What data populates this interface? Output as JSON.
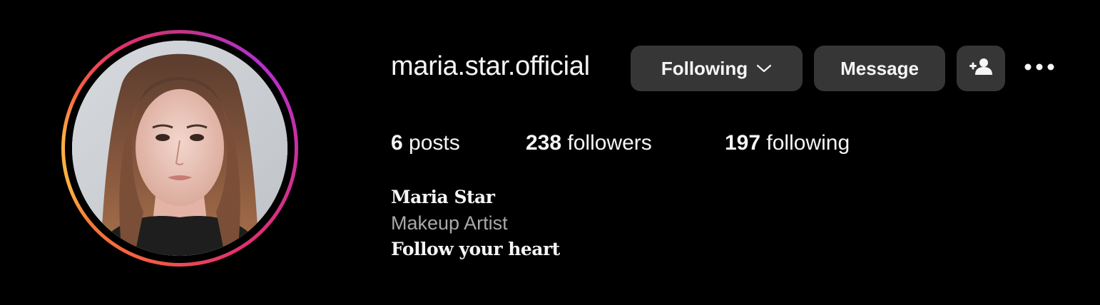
{
  "profile": {
    "username": "maria.star.official",
    "full_name": "Maria Star",
    "category": "Makeup Artist",
    "bio": "Follow your heart"
  },
  "actions": {
    "following_label": "Following",
    "message_label": "Message",
    "add_user_icon": "person-add-icon",
    "more_icon": "more-horizontal-icon"
  },
  "stats": {
    "posts_count": "6",
    "posts_label": "posts",
    "followers_count": "238",
    "followers_label": "followers",
    "following_count": "197",
    "following_label": "following"
  },
  "colors": {
    "background": "#000000",
    "button_bg": "#363636",
    "text_primary": "#f5f5f5",
    "text_secondary": "#a8a8a8",
    "ring_gradient": [
      "#fcaf45",
      "#f77737",
      "#f56040",
      "#e1306c",
      "#c13584",
      "#b52fd0"
    ]
  }
}
